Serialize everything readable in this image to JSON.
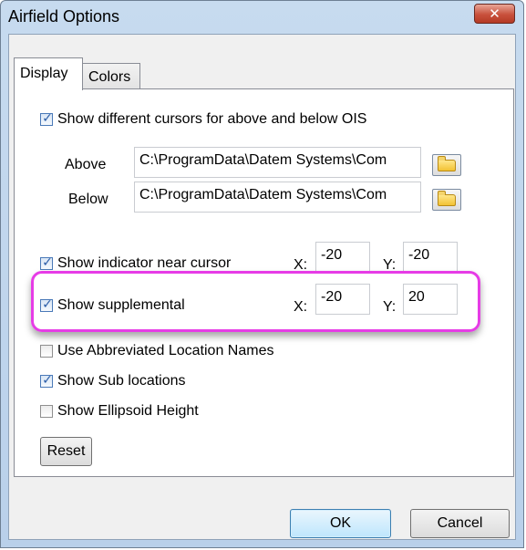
{
  "window": {
    "title": "Airfield Options",
    "close_label": "✕"
  },
  "tabs": [
    {
      "label": "Display",
      "active": true
    },
    {
      "label": "Colors",
      "active": false
    }
  ],
  "display": {
    "show_cursors": {
      "label": "Show different cursors for above and below OIS",
      "checked": true
    },
    "above": {
      "label": "Above",
      "value": "C:\\ProgramData\\Datem Systems\\Com"
    },
    "below": {
      "label": "Below",
      "value": "C:\\ProgramData\\Datem Systems\\Com"
    },
    "indicator": {
      "label": "Show indicator near cursor",
      "checked": true,
      "x_label": "X:",
      "x": "-20",
      "y_label": "Y:",
      "y": "-20"
    },
    "supplemental": {
      "label": "Show supplemental",
      "checked": true,
      "x_label": "X:",
      "x": "-20",
      "y_label": "Y:",
      "y": "20"
    },
    "abbrev": {
      "label": "Use Abbreviated Location Names",
      "checked": false
    },
    "sublocations": {
      "label": "Show Sub locations",
      "checked": true
    },
    "ellipsoid": {
      "label": "Show Ellipsoid Height",
      "checked": false
    },
    "reset_label": "Reset"
  },
  "buttons": {
    "ok": "OK",
    "cancel": "Cancel"
  },
  "colors": {
    "highlight": "#e63ce6",
    "check": "#2b5da8"
  },
  "icons": {
    "folder": "folder-icon",
    "check": "checkmark-icon",
    "close": "close-icon"
  }
}
